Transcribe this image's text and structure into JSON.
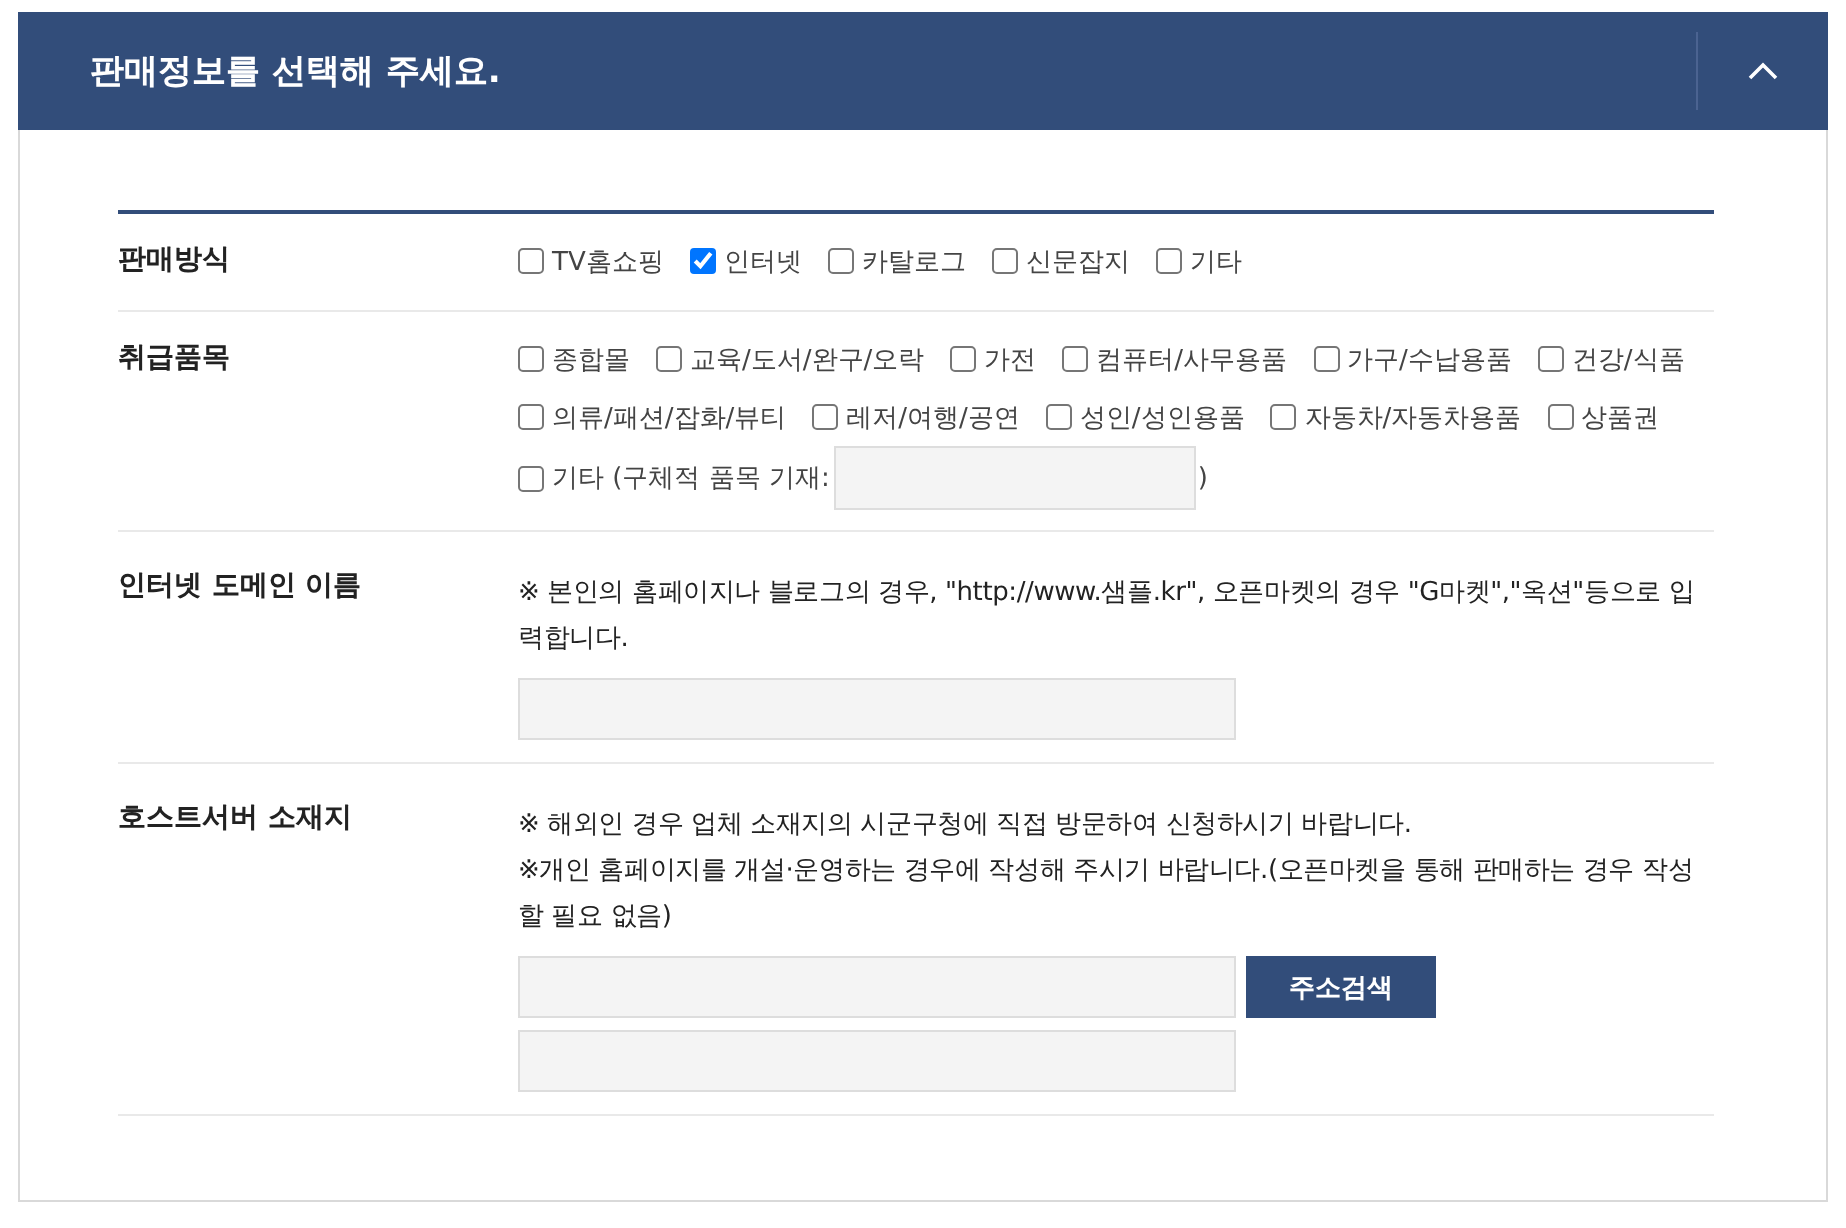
{
  "panel": {
    "title": "판매정보를 선택해 주세요.",
    "expanded": true
  },
  "fields": [
    {
      "kind": "checkboxes",
      "label": "판매방식",
      "options": [
        {
          "kind": "checkbox",
          "label": "TV홈쇼핑",
          "checked": false
        },
        {
          "kind": "checkbox",
          "label": "인터넷",
          "checked": true
        },
        {
          "kind": "checkbox",
          "label": "카탈로그",
          "checked": false
        },
        {
          "kind": "checkbox",
          "label": "신문잡지",
          "checked": false
        },
        {
          "kind": "checkbox",
          "label": "기타",
          "checked": false
        }
      ]
    },
    {
      "kind": "checkboxes",
      "label": "취급품목",
      "options": [
        {
          "kind": "checkbox",
          "label": "종합몰",
          "checked": false
        },
        {
          "kind": "checkbox",
          "label": "교육/도서/완구/오락",
          "checked": false
        },
        {
          "kind": "checkbox",
          "label": "가전",
          "checked": false
        },
        {
          "kind": "checkbox",
          "label": "컴퓨터/사무용품",
          "checked": false
        },
        {
          "kind": "checkbox",
          "label": "가구/수납용품",
          "checked": false
        },
        {
          "kind": "checkbox",
          "label": "건강/식품",
          "checked": false
        },
        {
          "kind": "checkbox",
          "label": "의류/패션/잡화/뷰티",
          "checked": false
        },
        {
          "kind": "checkbox",
          "label": "레저/여행/공연",
          "checked": false
        },
        {
          "kind": "checkbox",
          "label": "성인/성인용품",
          "checked": false
        },
        {
          "kind": "checkbox",
          "label": "자동차/자동차용품",
          "checked": false
        },
        {
          "kind": "checkbox",
          "label": "상품권",
          "checked": false
        },
        {
          "kind": "checkbox_input",
          "label": "기타 (구체적 품목 기재:",
          "checked": false,
          "suffix": ")"
        }
      ]
    },
    {
      "kind": "text_input",
      "label": "인터넷 도메인 이름",
      "notes": [
        "※ 본인의 홈페이지나 블로그의 경우, \"http://www.샘플.kr\", 오픈마켓의 경우 \"G마켓\",\"옥션\"등으로 입력합니다."
      ]
    },
    {
      "kind": "address",
      "label": "호스트서버 소재지",
      "notes": [
        "※ 해외인 경우 업체 소재지의 시군구청에 직접 방문하여 신청하시기 바랍니다.",
        "※개인 홈페이지를 개설·운영하는 경우에 작성해 주시기 바랍니다.(오픈마켓을 통해 판매하는 경우 작성할 필요 없음)"
      ],
      "search_button": "주소검색"
    }
  ]
}
